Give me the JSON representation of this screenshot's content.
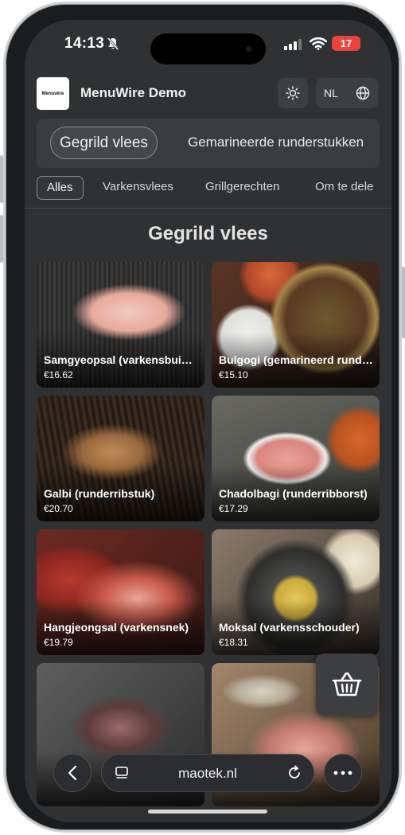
{
  "status": {
    "time": "14:13",
    "battery": "17"
  },
  "header": {
    "logo_text": "Menuwire",
    "title": "MenuWire Demo",
    "language": "NL"
  },
  "categories": {
    "active": "Gegrild vlees",
    "next": "Gemarineerde runderstukken"
  },
  "subcategories": [
    "Alles",
    "Varkensvlees",
    "Grillgerechten",
    "Om te dele"
  ],
  "section": {
    "title": "Gegrild vlees"
  },
  "items": [
    {
      "name": "Samgyeopsal (varkensbuikspek)",
      "price": "€16.62"
    },
    {
      "name": "Bulgogi (gemarineerd rundvlees)",
      "price": "€15.10"
    },
    {
      "name": "Galbi (runderribstuk)",
      "price": "€20.70"
    },
    {
      "name": "Chadolbagi (runderribborst)",
      "price": "€17.29"
    },
    {
      "name": "Hangjeongsal (varkensnek)",
      "price": "€19.79"
    },
    {
      "name": "Moksal (varkensschouder)",
      "price": "€18.31"
    },
    {
      "name": "",
      "price": ""
    },
    {
      "name": "",
      "price": ""
    }
  ],
  "browser": {
    "url": "maotek.nl"
  },
  "colors": {
    "background": "#2f3133",
    "surface": "#3a3c3f",
    "battery": "#e8443b"
  },
  "icons": {
    "status": [
      "bell-slash-icon",
      "signal-icon",
      "wifi-icon",
      "battery-icon"
    ],
    "header": [
      "sun-icon",
      "globe-icon"
    ],
    "floating": [
      "basket-icon"
    ],
    "browser": [
      "back-icon",
      "tabs-icon",
      "reload-icon",
      "more-icon"
    ]
  }
}
